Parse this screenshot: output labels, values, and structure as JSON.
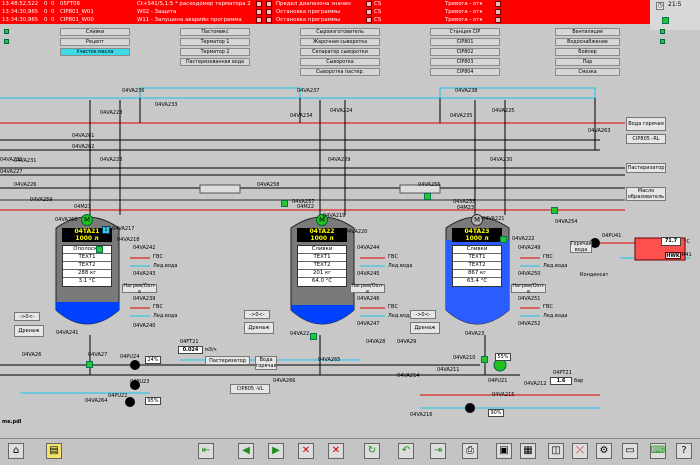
{
  "clock": "21:5",
  "alarms": [
    {
      "ts": "13:48:52,522",
      "d": "0",
      "q": "0",
      "tag": "05FT06",
      "msg": "Ct+S41/S,1:5 * расходомер терматора 2",
      "msg2": "Предел диапазона значен",
      "c": "CS",
      "state": "Тревога - отк"
    },
    {
      "ts": "13:34:30,965",
      "d": "0",
      "q": "0",
      "tag": "CIP801_W01",
      "msg": "W02 - Защита",
      "msg2": "Остановка программы",
      "c": "CS",
      "state": "Тревога - отк"
    },
    {
      "ts": "13:34:30,965",
      "d": "0",
      "q": "0",
      "tag": "CIP801_W00",
      "msg": "W11 - Запущена аварийн программа",
      "msg2": "Остановка программы",
      "c": "CS",
      "state": "Тревога - отк"
    }
  ],
  "nav": [
    [
      "Сливки",
      "Пастомикс",
      "Сыроизготовитель",
      "Станция CIP",
      "Вентиляция"
    ],
    [
      "Рецепт",
      "Терматор 1",
      "Жарочная сыворотка",
      "CIP801",
      "Водоснабжение"
    ],
    [
      "Участок масла",
      "Терматор 2",
      "Сепаратор сыворотки",
      "CIP802",
      "Бойлер"
    ],
    [
      "",
      "Пастеризованная вода",
      "Сыворотка",
      "CIP803",
      "Пар"
    ],
    [
      "",
      "",
      "Сыворотка пастер.",
      "CIP804",
      "Смазка"
    ]
  ],
  "valves": {
    "v236": "04VA236",
    "v237": "04VA237",
    "v238": "04VA238",
    "v233": "04VA233",
    "v223": "04VA223",
    "v234": "04VA234",
    "v224": "04VA224",
    "v235": "04VA235",
    "v225": "04VA225",
    "v263": "04VA263",
    "v261": "04VA261",
    "v262": "04VA262",
    "v231": "04VA231",
    "v228": "04VA228",
    "v229": "04VA229",
    "v230": "04VA230",
    "v226": "04VA226",
    "v258": "04VA258",
    "v256": "04VA256",
    "v259": "04VA259",
    "v257": "04VA257",
    "v255": "04VA255",
    "v254": "04VA254",
    "v260": "04VA260",
    "v217": "04VA217",
    "v219": "04VA219",
    "v220": "04VA220",
    "v221": "04VA221",
    "v222": "04VA222",
    "v218": "04VA218",
    "v242": "04VA242",
    "v244": "04VA244",
    "v249": "04VA249",
    "v243": "04VA243",
    "v245": "04VA245",
    "v250": "04VA250",
    "v239": "04VA239",
    "v246": "04VA246",
    "v251": "04VA251",
    "v240": "04VA240",
    "v247": "04VA247",
    "v252": "04VA252",
    "v241": "04VA241",
    "v22": "04VA22",
    "v23": "04VA23",
    "v26": "04VA26",
    "v27": "04VA27",
    "v28": "04VA28",
    "v29": "04VA29",
    "v265": "04VA265",
    "v266": "04VA266",
    "v264": "04VA264",
    "v210": "04VA210",
    "v211": "04VA211",
    "v214": "04VA214",
    "v212": "04VA212",
    "v215": "04VA215",
    "v216": "04VA216",
    "v232": "04VA232",
    "v227": "04VA227",
    "v41": "04VR41"
  },
  "tanks": [
    {
      "name": "04TA21",
      "vol": "1000 л",
      "m": "04M21",
      "p": "04M21",
      "product": "Ополоски",
      "t1": "TEXT1",
      "t2": "TEXT2",
      "mass": "288  кг",
      "temp": "3.1  °C"
    },
    {
      "name": "04TA22",
      "vol": "1000 л",
      "m": "04M22",
      "p": "04M22",
      "product": "Сливки",
      "t1": "TEXT1",
      "t2": "TEXT2",
      "mass": "201  кг",
      "temp": "64.0  °C"
    },
    {
      "name": "04TA23",
      "vol": "1000 л",
      "m": "04M23",
      "p": "04M23",
      "product": "Сливки",
      "t1": "TEXT1",
      "t2": "TEXT2",
      "mass": "867  кг",
      "temp": "63.4  °C"
    }
  ],
  "labels": {
    "water_hot": "Вода горячая",
    "cip805_rl": "CIP805 -RL",
    "pasteurizer": "Пастеризатор",
    "oil_former": "Масло образователь",
    "gvs": "ГВС",
    "ice_water": "Лед.вода",
    "heat_cool": "Нагрев/Охл-е",
    "drain": "Дренаж",
    "arrows": "->0<-",
    "hot_water": "Горячая вода",
    "condensate": "Конденсат",
    "hwk": "HWK",
    "pasteurizer2": "Пастеризатор",
    "water_hot2": "Вода горячая",
    "cip805_vl": "CIP805 -VL",
    "file": "me.pdl",
    "pu24": "04PU24",
    "pu23": "04PU23",
    "pu22": "04PU22",
    "pu21": "04PU21",
    "pu41": "04PU41",
    "ft21": "04FT21",
    "ft21_val": "0.024",
    "ft21_unit": "м3/ч",
    "pt21": "04PT21",
    "pt21_val": "1.6",
    "pt21_unit": "бар",
    "hwk_temp": "71.7",
    "hwk_unit": "°C",
    "pct24": "24%",
    "pct95": "95%",
    "pct55": "55%",
    "pct90": "90%",
    "s1": "1"
  }
}
